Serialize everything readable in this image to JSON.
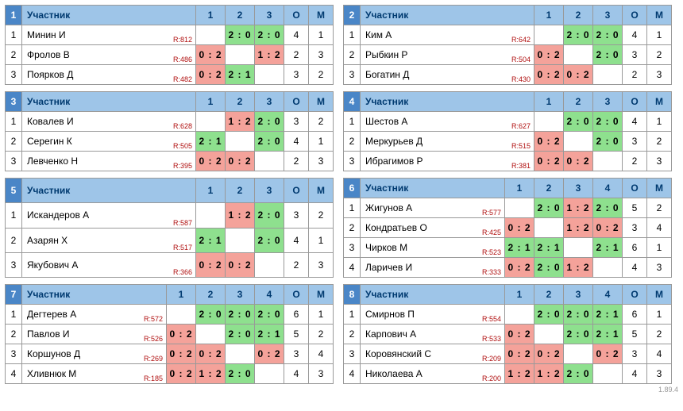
{
  "labels": {
    "participant": "Участник",
    "o": "О",
    "m": "М",
    "rating_prefix": "R:"
  },
  "version": "1.89.4",
  "colors": {
    "header_light": "#9ec5e8",
    "header_dark": "#4a86c7",
    "win": "#8ee08e",
    "lose": "#f4a29a"
  },
  "groups": [
    {
      "number": 1,
      "players": [
        {
          "name": "Минин И",
          "rating": 812,
          "scores": [
            null,
            "2 : 0",
            "2 : 0"
          ],
          "out": [
            null,
            "w",
            "w"
          ],
          "o": 4,
          "m": 1
        },
        {
          "name": "Фролов В",
          "rating": 486,
          "scores": [
            "0 : 2",
            null,
            "1 : 2"
          ],
          "out": [
            "l",
            null,
            "l"
          ],
          "o": 2,
          "m": 3
        },
        {
          "name": "Поярков Д",
          "rating": 482,
          "scores": [
            "0 : 2",
            "2 : 1",
            null
          ],
          "out": [
            "l",
            "w",
            null
          ],
          "o": 3,
          "m": 2
        }
      ]
    },
    {
      "number": 2,
      "players": [
        {
          "name": "Ким А",
          "rating": 642,
          "scores": [
            null,
            "2 : 0",
            "2 : 0"
          ],
          "out": [
            null,
            "w",
            "w"
          ],
          "o": 4,
          "m": 1
        },
        {
          "name": "Рыбкин Р",
          "rating": 504,
          "scores": [
            "0 : 2",
            null,
            "2 : 0"
          ],
          "out": [
            "l",
            null,
            "w"
          ],
          "o": 3,
          "m": 2
        },
        {
          "name": "Богатин Д",
          "rating": 430,
          "scores": [
            "0 : 2",
            "0 : 2",
            null
          ],
          "out": [
            "l",
            "l",
            null
          ],
          "o": 2,
          "m": 3
        }
      ]
    },
    {
      "number": 3,
      "players": [
        {
          "name": "Ковалев И",
          "rating": 628,
          "scores": [
            null,
            "1 : 2",
            "2 : 0"
          ],
          "out": [
            null,
            "l",
            "w"
          ],
          "o": 3,
          "m": 2
        },
        {
          "name": "Серегин К",
          "rating": 505,
          "scores": [
            "2 : 1",
            null,
            "2 : 0"
          ],
          "out": [
            "w",
            null,
            "w"
          ],
          "o": 4,
          "m": 1
        },
        {
          "name": "Левченко Н",
          "rating": 395,
          "scores": [
            "0 : 2",
            "0 : 2",
            null
          ],
          "out": [
            "l",
            "l",
            null
          ],
          "o": 2,
          "m": 3
        }
      ]
    },
    {
      "number": 4,
      "players": [
        {
          "name": "Шестов А",
          "rating": 627,
          "scores": [
            null,
            "2 : 0",
            "2 : 0"
          ],
          "out": [
            null,
            "w",
            "w"
          ],
          "o": 4,
          "m": 1
        },
        {
          "name": "Меркурьев Д",
          "rating": 515,
          "scores": [
            "0 : 2",
            null,
            "2 : 0"
          ],
          "out": [
            "l",
            null,
            "w"
          ],
          "o": 3,
          "m": 2
        },
        {
          "name": "Ибрагимов Р",
          "rating": 381,
          "scores": [
            "0 : 2",
            "0 : 2",
            null
          ],
          "out": [
            "l",
            "l",
            null
          ],
          "o": 2,
          "m": 3
        }
      ]
    },
    {
      "number": 5,
      "players": [
        {
          "name": "Искандеров А",
          "rating": 587,
          "scores": [
            null,
            "1 : 2",
            "2 : 0"
          ],
          "out": [
            null,
            "l",
            "w"
          ],
          "o": 3,
          "m": 2
        },
        {
          "name": "Азарян Х",
          "rating": 517,
          "scores": [
            "2 : 1",
            null,
            "2 : 0"
          ],
          "out": [
            "w",
            null,
            "w"
          ],
          "o": 4,
          "m": 1
        },
        {
          "name": "Якубович А",
          "rating": 366,
          "scores": [
            "0 : 2",
            "0 : 2",
            null
          ],
          "out": [
            "l",
            "l",
            null
          ],
          "o": 2,
          "m": 3
        }
      ]
    },
    {
      "number": 6,
      "players": [
        {
          "name": "Жигунов А",
          "rating": 577,
          "scores": [
            null,
            "2 : 0",
            "1 : 2",
            "2 : 0"
          ],
          "out": [
            null,
            "w",
            "l",
            "w"
          ],
          "o": 5,
          "m": 2
        },
        {
          "name": "Кондратьев О",
          "rating": 425,
          "scores": [
            "0 : 2",
            null,
            "1 : 2",
            "0 : 2"
          ],
          "out": [
            "l",
            null,
            "l",
            "l"
          ],
          "o": 3,
          "m": 4
        },
        {
          "name": "Чирков М",
          "rating": 523,
          "scores": [
            "2 : 1",
            "2 : 1",
            null,
            "2 : 1"
          ],
          "out": [
            "w",
            "w",
            null,
            "w"
          ],
          "o": 6,
          "m": 1
        },
        {
          "name": "Ларичев И",
          "rating": 333,
          "scores": [
            "0 : 2",
            "2 : 0",
            "1 : 2",
            null
          ],
          "out": [
            "l",
            "w",
            "l",
            null
          ],
          "o": 4,
          "m": 3
        }
      ]
    },
    {
      "number": 7,
      "players": [
        {
          "name": "Дегтерев А",
          "rating": 572,
          "scores": [
            null,
            "2 : 0",
            "2 : 0",
            "2 : 0"
          ],
          "out": [
            null,
            "w",
            "w",
            "w"
          ],
          "o": 6,
          "m": 1
        },
        {
          "name": "Павлов И",
          "rating": 526,
          "scores": [
            "0 : 2",
            null,
            "2 : 0",
            "2 : 1"
          ],
          "out": [
            "l",
            null,
            "w",
            "w"
          ],
          "o": 5,
          "m": 2
        },
        {
          "name": "Коршунов Д",
          "rating": 269,
          "scores": [
            "0 : 2",
            "0 : 2",
            null,
            "0 : 2"
          ],
          "out": [
            "l",
            "l",
            null,
            "l"
          ],
          "o": 3,
          "m": 4
        },
        {
          "name": "Хливнюк М",
          "rating": 185,
          "scores": [
            "0 : 2",
            "1 : 2",
            "2 : 0",
            null
          ],
          "out": [
            "l",
            "l",
            "w",
            null
          ],
          "o": 4,
          "m": 3
        }
      ]
    },
    {
      "number": 8,
      "players": [
        {
          "name": "Смирнов П",
          "rating": 554,
          "scores": [
            null,
            "2 : 0",
            "2 : 0",
            "2 : 1"
          ],
          "out": [
            null,
            "w",
            "w",
            "w"
          ],
          "o": 6,
          "m": 1
        },
        {
          "name": "Карпович А",
          "rating": 533,
          "scores": [
            "0 : 2",
            null,
            "2 : 0",
            "2 : 1"
          ],
          "out": [
            "l",
            null,
            "w",
            "w"
          ],
          "o": 5,
          "m": 2
        },
        {
          "name": "Коровянский С",
          "rating": 209,
          "scores": [
            "0 : 2",
            "0 : 2",
            null,
            "0 : 2"
          ],
          "out": [
            "l",
            "l",
            null,
            "l"
          ],
          "o": 3,
          "m": 4
        },
        {
          "name": "Николаева А",
          "rating": 200,
          "scores": [
            "1 : 2",
            "1 : 2",
            "2 : 0",
            null
          ],
          "out": [
            "l",
            "l",
            "w",
            null
          ],
          "o": 4,
          "m": 3
        }
      ]
    }
  ]
}
